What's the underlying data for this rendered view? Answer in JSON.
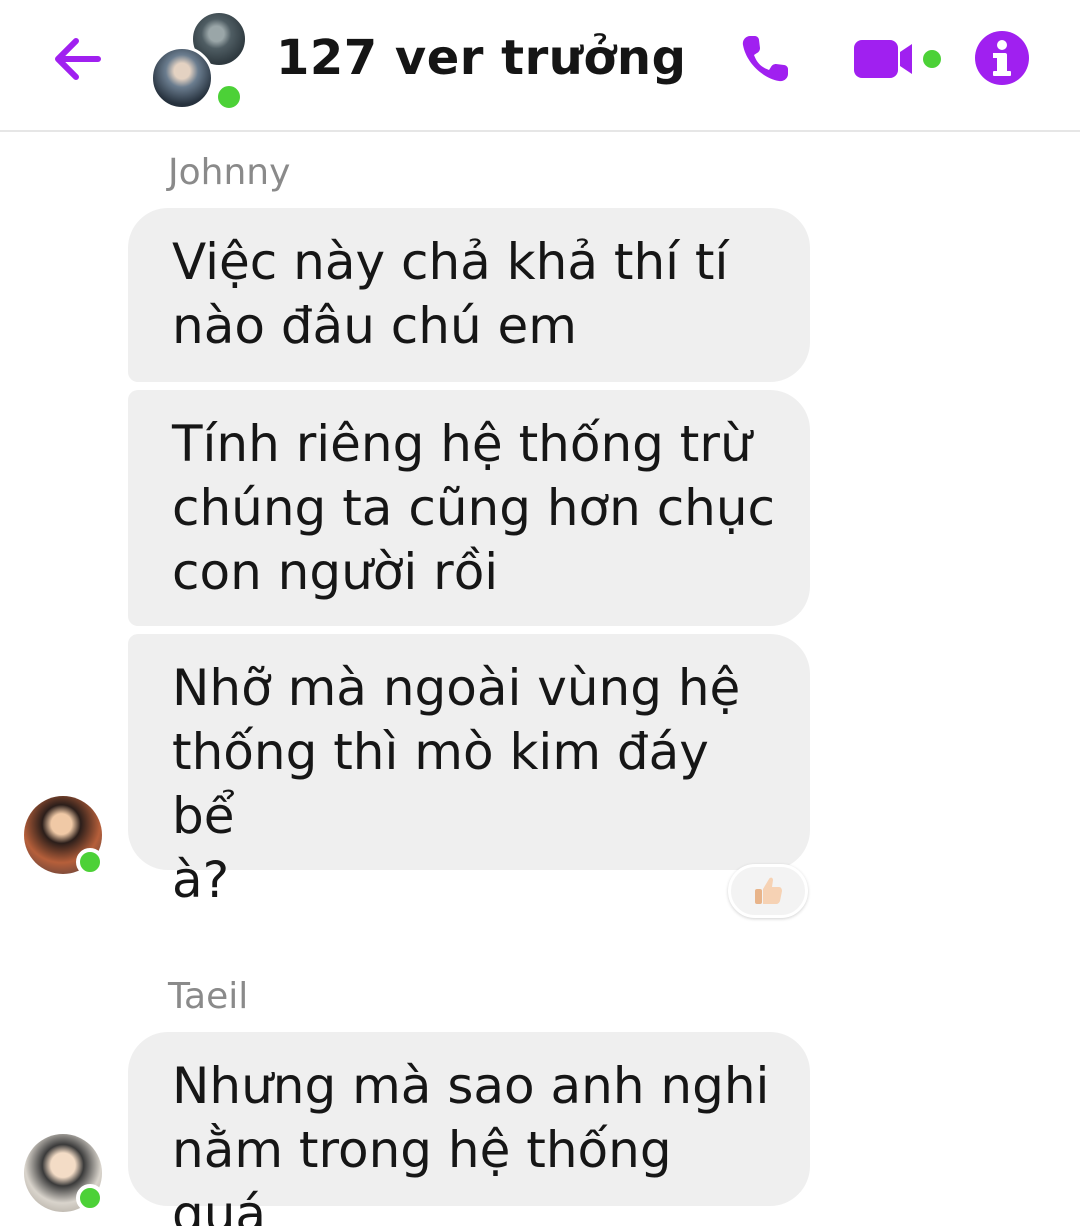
{
  "header": {
    "title": "127 ver trưởng",
    "back_icon": "arrow-left-icon",
    "call_icon": "phone-icon",
    "video_icon": "video-camera-icon",
    "info_icon": "info-icon",
    "accent_color": "#a020f0",
    "online_color": "#4cd137"
  },
  "messages": [
    {
      "sender": "Johnny",
      "bubbles": [
        {
          "lines": [
            "Việc này chả khả thí tí",
            "nào đâu chú em"
          ]
        },
        {
          "lines": [
            "Tính riêng hệ thống trừ",
            "chúng ta cũng hơn chục",
            "con người rồi"
          ]
        },
        {
          "lines": [
            "Nhỡ mà ngoài vùng hệ",
            "thống thì mò kim đáy bể",
            "à?"
          ]
        }
      ],
      "reaction": "thumbs-up-icon"
    },
    {
      "sender": "Taeil",
      "bubbles": [
        {
          "lines": [
            "Nhưng mà sao anh nghi",
            "nằm trong hệ thống quá"
          ]
        }
      ]
    }
  ]
}
